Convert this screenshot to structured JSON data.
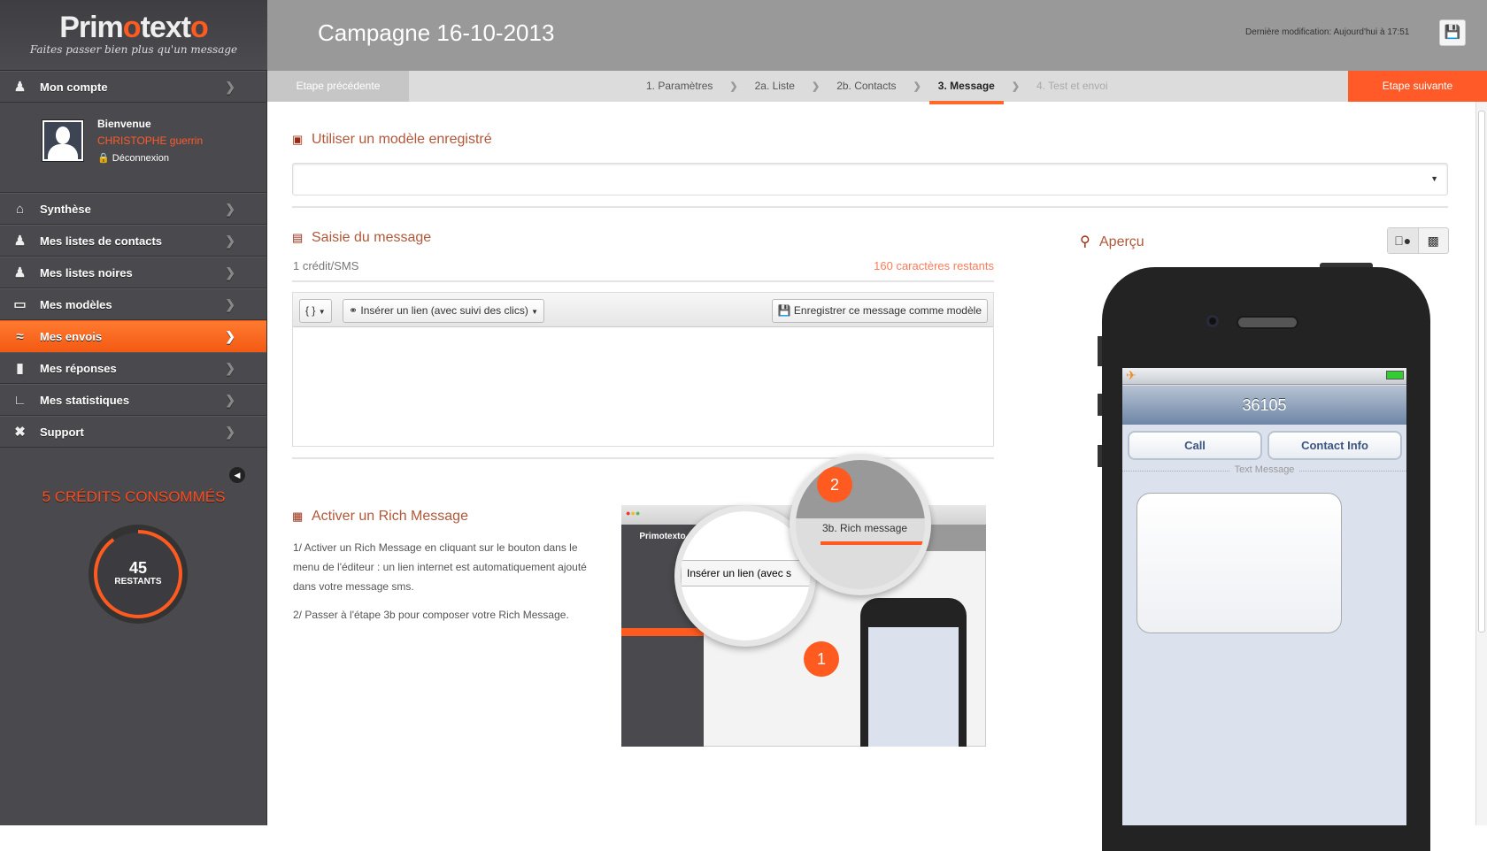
{
  "brand": {
    "name_a": "Prim",
    "name_o": "o",
    "name_b": "text",
    "name_c": "o",
    "tagline": "Faites passer bien plus qu'un message"
  },
  "sidebar": {
    "account": {
      "label": "Mon compte",
      "icon": "user-icon"
    },
    "profile": {
      "welcome": "Bienvenue",
      "user": "CHRISTOPHE guerrin",
      "logout": "Déconnexion"
    },
    "items": [
      {
        "label": "Synthèse",
        "icon": "home-icon"
      },
      {
        "label": "Mes listes de contacts",
        "icon": "users-check-icon"
      },
      {
        "label": "Mes listes noires",
        "icon": "users-x-icon"
      },
      {
        "label": "Mes modèles",
        "icon": "folder-icon"
      },
      {
        "label": "Mes envois",
        "icon": "wifi-icon",
        "active": true
      },
      {
        "label": "Mes réponses",
        "icon": "speech-bubble-icon"
      },
      {
        "label": "Mes statistiques",
        "icon": "chart-icon"
      },
      {
        "label": "Support",
        "icon": "tools-icon"
      }
    ],
    "credits": {
      "consumed": "5 CRÉDITS CONSOMMÉS",
      "remaining": "45",
      "remaining_label": "RESTANTS",
      "remaining_fraction": 0.9
    }
  },
  "header": {
    "title": "Campagne 16-10-2013",
    "last_modified": "Dernière modification: Aujourd'hui à 17:51"
  },
  "steps": {
    "prev": "Etape précédente",
    "next": "Etape suivante",
    "items": [
      {
        "label": "1. Paramètres",
        "state": "done"
      },
      {
        "label": "2a. Liste",
        "state": "done"
      },
      {
        "label": "2b. Contacts",
        "state": "done"
      },
      {
        "label": "3. Message",
        "state": "current"
      },
      {
        "label": "4. Test et envoi",
        "state": "disabled"
      }
    ]
  },
  "template": {
    "title": "Utiliser un modèle enregistré",
    "selected": ""
  },
  "compose": {
    "title": "Saisie du message",
    "credit": "1 crédit/SMS",
    "remaining": "160 caractères restants",
    "vars_btn": "{ }",
    "link_btn": "Insérer un lien (avec suivi des clics)",
    "save_btn": "Enregistrer ce message comme modèle",
    "text": ""
  },
  "rich": {
    "title": "Activer un Rich Message",
    "p1": "1/ Activer un Rich Message en cliquant sur le bouton dans le menu de l'éditeur : un lien internet est automatiquement ajouté dans votre message sms.",
    "p2": "2/ Passer à l'étape 3b pour composer votre Rich Message.",
    "illus": {
      "badge1": "1",
      "badge2": "2",
      "zoom1": "Insérer un lien (avec s",
      "zoom2": "3b. Rich message",
      "mini_brand": "Primotexto"
    }
  },
  "preview": {
    "title": "Aperçu",
    "sender": "36105",
    "call": "Call",
    "contact": "Contact Info",
    "text_label": "Text Message"
  },
  "colors": {
    "accent": "#ff5a1f",
    "sidebar": "#4a4a4e",
    "header": "#999999",
    "section_title": "#b0583a"
  }
}
